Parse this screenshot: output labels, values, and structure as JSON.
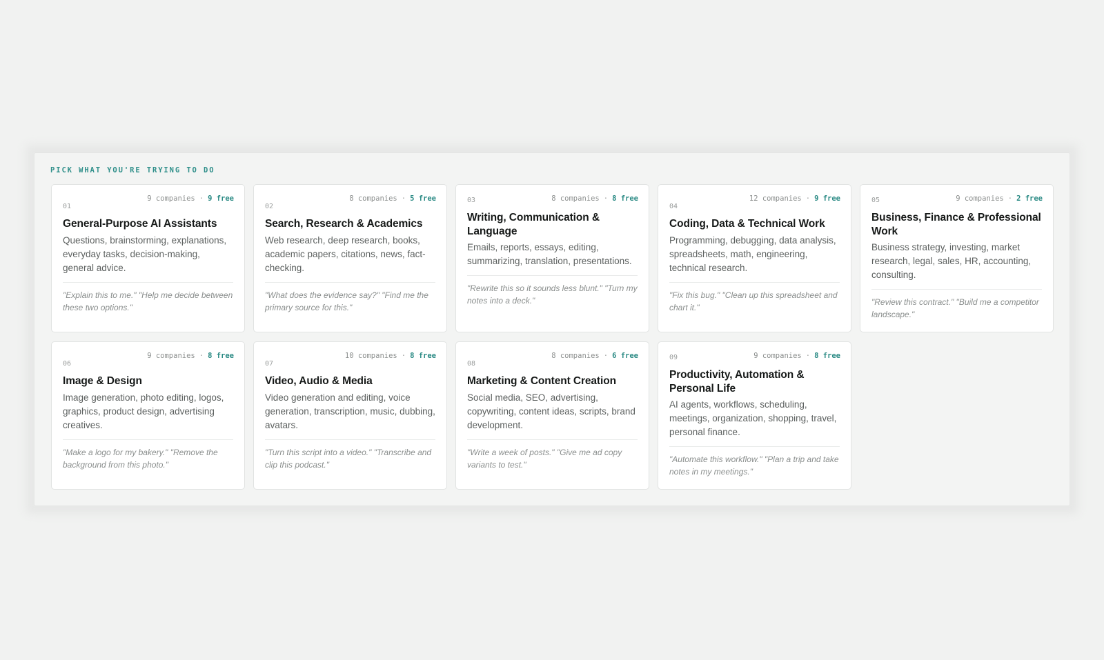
{
  "section_label": "PICK WHAT YOU'RE TRYING TO DO",
  "categories": [
    {
      "number": "01",
      "companies": "9 companies",
      "free": "9 free",
      "title": "General-Purpose AI Assistants",
      "description": "Questions, brainstorming, explanations, everyday tasks, decision-making, general advice.",
      "examples": "\"Explain this to me.\" \"Help me decide between these two options.\""
    },
    {
      "number": "02",
      "companies": "8 companies",
      "free": "5 free",
      "title": "Search, Research & Academics",
      "description": "Web research, deep research, books, academic papers, citations, news, fact-checking.",
      "examples": "\"What does the evidence say?\" \"Find me the primary source for this.\""
    },
    {
      "number": "03",
      "companies": "8 companies",
      "free": "8 free",
      "title": "Writing, Communication & Language",
      "description": "Emails, reports, essays, editing, summarizing, translation, presentations.",
      "examples": "\"Rewrite this so it sounds less blunt.\" \"Turn my notes into a deck.\""
    },
    {
      "number": "04",
      "companies": "12 companies",
      "free": "9 free",
      "title": "Coding, Data & Technical Work",
      "description": "Programming, debugging, data analysis, spreadsheets, math, engineering, technical research.",
      "examples": "\"Fix this bug.\" \"Clean up this spreadsheet and chart it.\""
    },
    {
      "number": "05",
      "companies": "9 companies",
      "free": "2 free",
      "title": "Business, Finance & Professional Work",
      "description": "Business strategy, investing, market research, legal, sales, HR, accounting, consulting.",
      "examples": "\"Review this contract.\" \"Build me a competitor landscape.\""
    },
    {
      "number": "06",
      "companies": "9 companies",
      "free": "8 free",
      "title": "Image & Design",
      "description": "Image generation, photo editing, logos, graphics, product design, advertising creatives.",
      "examples": "\"Make a logo for my bakery.\" \"Remove the background from this photo.\""
    },
    {
      "number": "07",
      "companies": "10 companies",
      "free": "8 free",
      "title": "Video, Audio & Media",
      "description": "Video generation and editing, voice generation, transcription, music, dubbing, avatars.",
      "examples": "\"Turn this script into a video.\" \"Transcribe and clip this podcast.\""
    },
    {
      "number": "08",
      "companies": "8 companies",
      "free": "6 free",
      "title": "Marketing & Content Creation",
      "description": "Social media, SEO, advertising, copywriting, content ideas, scripts, brand development.",
      "examples": "\"Write a week of posts.\" \"Give me ad copy variants to test.\""
    },
    {
      "number": "09",
      "companies": "9 companies",
      "free": "8 free",
      "title": "Productivity, Automation & Personal Life",
      "description": "AI agents, workflows, scheduling, meetings, organization, shopping, travel, personal finance.",
      "examples": "\"Automate this workflow.\" \"Plan a trip and take notes in my meetings.\""
    }
  ],
  "colors": {
    "accent": "#2a8a84",
    "page_bg": "#f1f2f1",
    "card_bg": "#ffffff",
    "title_text": "#161918"
  }
}
